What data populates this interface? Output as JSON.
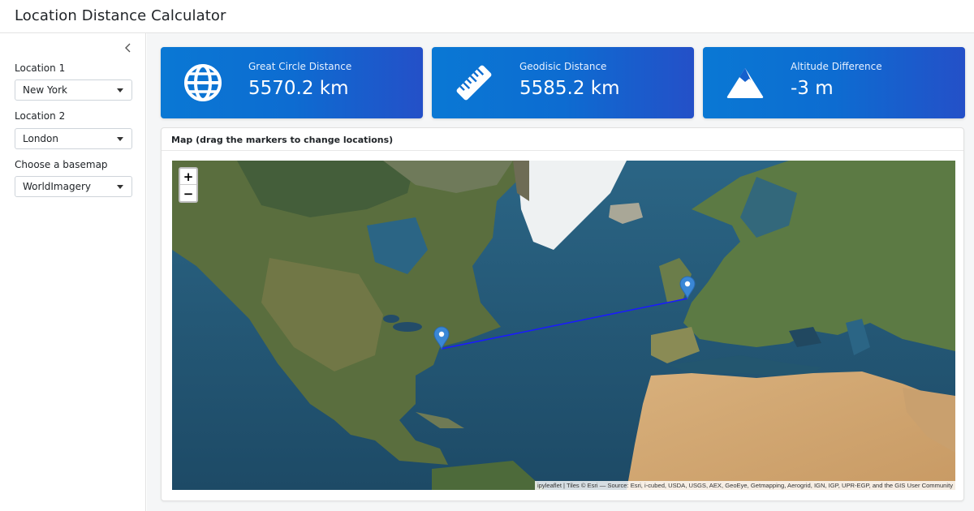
{
  "app": {
    "title": "Location Distance Calculator"
  },
  "sidebar": {
    "location1": {
      "label": "Location 1",
      "value": "New York"
    },
    "location2": {
      "label": "Location 2",
      "value": "London"
    },
    "basemap": {
      "label": "Choose a basemap",
      "value": "WorldImagery"
    }
  },
  "stats": [
    {
      "label": "Great Circle Distance",
      "value": "5570.2 km",
      "icon": "globe-icon"
    },
    {
      "label": "Geodisic Distance",
      "value": "5585.2 km",
      "icon": "ruler-icon"
    },
    {
      "label": "Altitude Difference",
      "value": "-3 m",
      "icon": "mountain-icon"
    }
  ],
  "map": {
    "title": "Map (drag the markers to change locations)",
    "zoom_in": "+",
    "zoom_out": "−",
    "attribution": "ipyleaflet | Tiles © Esri — Source: Esri, i-cubed, USDA, USGS, AEX, GeoEye, Getmapping, Aerogrid, IGN, IGP, UPR-EGP, and the GIS User Community",
    "markers": [
      {
        "name": "New York",
        "color": "#3a87d6"
      },
      {
        "name": "London",
        "color": "#3a87d6"
      }
    ],
    "route_color": "#1a1aff"
  },
  "colors": {
    "card_start": "#0a78d4",
    "card_end": "#2450c8"
  }
}
